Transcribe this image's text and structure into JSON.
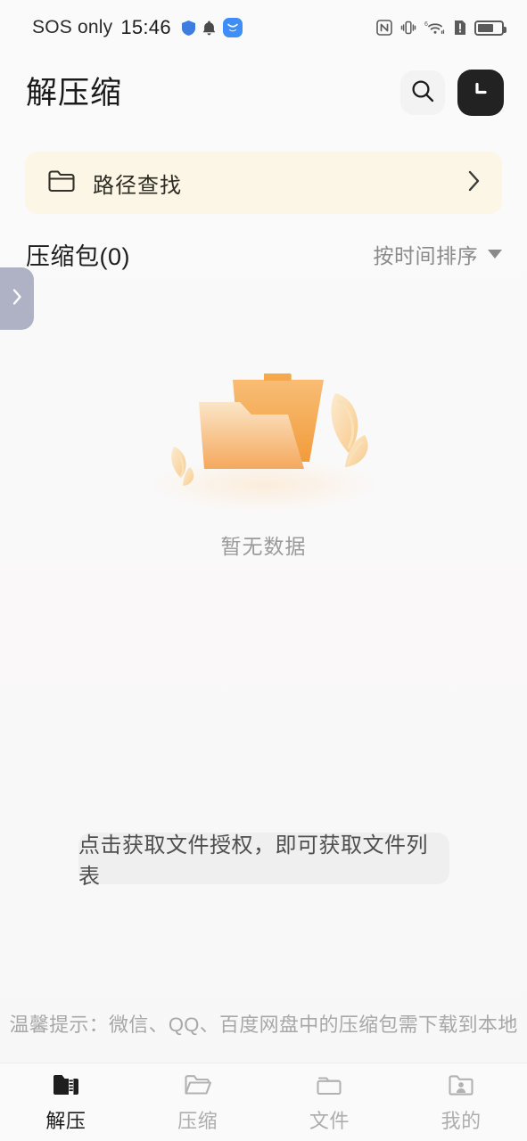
{
  "statusbar": {
    "carrier": "SOS only",
    "time": "15:46",
    "left_icons": [
      "shield-icon",
      "bell-icon",
      "app-badge-icon"
    ],
    "right_icons": [
      "nfc-icon",
      "vibrate-icon",
      "wifi6-icon",
      "sim-alert-icon",
      "battery-icon"
    ],
    "wifi_generation": "6",
    "battery_level": "68"
  },
  "header": {
    "title": "解压缩",
    "search_icon": "search-icon",
    "history_icon": "clock-history-icon"
  },
  "path_banner": {
    "icon": "folder-outline-icon",
    "label": "路径查找",
    "chevron": "chevron-right-icon"
  },
  "list_header": {
    "title": "压缩包(0)",
    "sort_label": "按时间排序",
    "sort_caret": "caret-down-icon"
  },
  "drawer_handle": {
    "icon": "chevron-right-icon"
  },
  "empty_state": {
    "illustration": "empty-folder-illustration",
    "text": "暂无数据"
  },
  "auth_prompt": {
    "text": "点击获取文件授权，即可获取文件列表"
  },
  "footer_tip": {
    "text": "温馨提示：微信、QQ、百度网盘中的压缩包需下载到本地"
  },
  "bottom_nav": {
    "items": [
      {
        "label": "解压",
        "icon": "zip-folder-icon",
        "active": true
      },
      {
        "label": "压缩",
        "icon": "folder-open-icon",
        "active": false
      },
      {
        "label": "文件",
        "icon": "folder-icon",
        "active": false
      },
      {
        "label": "我的",
        "icon": "folder-person-icon",
        "active": false
      }
    ]
  },
  "colors": {
    "background": "#FAF9F9",
    "banner_cream": "#FBF6E5",
    "accent_orange": "#F5A44B",
    "dark_button": "#222222",
    "drawer_handle": "#AEB2C4",
    "muted_text": "#8A8A8A"
  }
}
